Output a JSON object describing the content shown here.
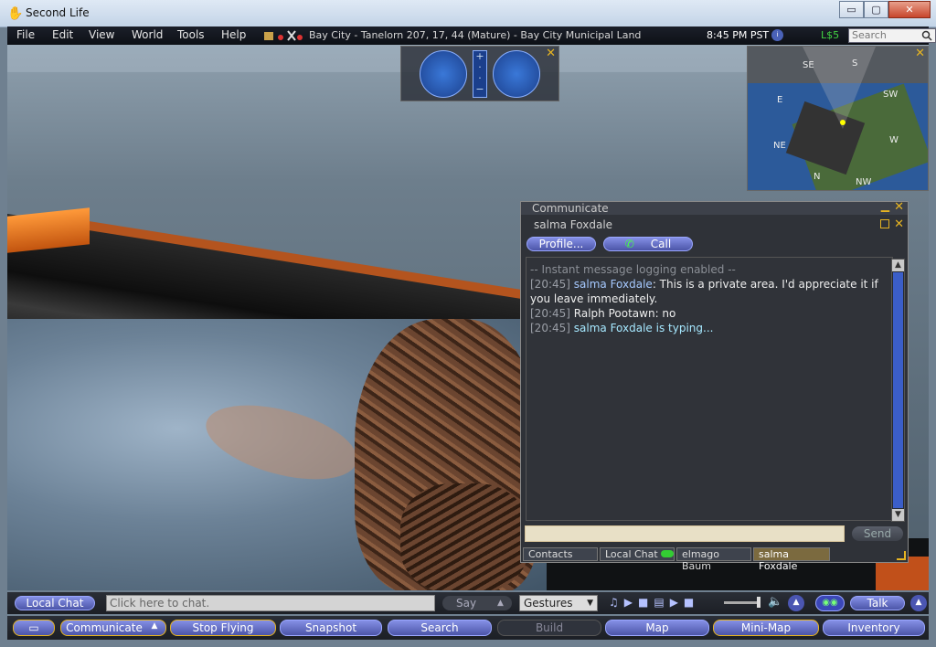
{
  "window": {
    "title": "Second Life",
    "minimize": "▭",
    "maximize": "▢",
    "close": "✕"
  },
  "menu": {
    "items": [
      "File",
      "Edit",
      "View",
      "World",
      "Tools",
      "Help"
    ],
    "location": "Bay City - Tanelorn 207, 17, 44 (Mature) - Bay City Municipal Land",
    "time": "8:45 PM PST",
    "balance": "L$5",
    "search_placeholder": "Search"
  },
  "minimap": {
    "directions": [
      "SE",
      "S",
      "SW",
      "E",
      "W",
      "NE",
      "N",
      "NW"
    ]
  },
  "communicate": {
    "title": "Communicate",
    "session": "salma Foxdale",
    "profile_label": "Profile...",
    "call_label": "Call",
    "send_label": "Send",
    "input_value": "",
    "history": [
      {
        "type": "system",
        "text": "-- Instant message logging enabled --"
      },
      {
        "type": "msg",
        "time": "[20:45]",
        "name": "salma Foxdale",
        "text": ": This is a private area. I'd appreciate it if you leave immediately."
      },
      {
        "type": "plain",
        "time": "[20:45]",
        "name": "Ralph Pootawn",
        "text": ": no"
      },
      {
        "type": "typing",
        "time": "[20:45]",
        "name": "salma Foxdale is typing..."
      }
    ],
    "tabs": [
      "Contacts",
      "Local Chat",
      "elmago Baum",
      "salma Foxdale"
    ]
  },
  "chatbar": {
    "local_chat": "Local Chat",
    "chat_placeholder": "Click here to chat.",
    "say": "Say",
    "gestures": "Gestures",
    "talk": "Talk"
  },
  "toolbar": {
    "communicate": "Communicate",
    "stop_flying": "Stop Flying",
    "snapshot": "Snapshot",
    "search": "Search",
    "build": "Build",
    "map": "Map",
    "minimap": "Mini-Map",
    "inventory": "Inventory"
  },
  "colors": {
    "accent_blue": "#4c55a8",
    "close_yellow": "#e6b422",
    "balance_green": "#42d442"
  }
}
